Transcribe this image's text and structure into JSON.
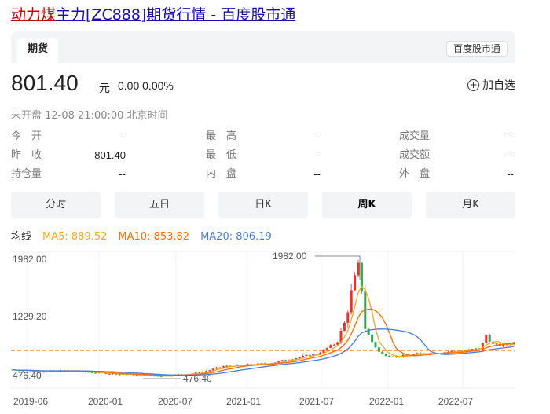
{
  "title": {
    "highlight": "动力煤",
    "rest": "主力[ZC888]期货行情 - 百度股市通"
  },
  "tab_active": "期货",
  "source_tag": "百度股市通",
  "quote": {
    "price": "801.40",
    "unit": "元",
    "change": "0.00 0.00%",
    "watch_label": "加自选"
  },
  "status": "未开盘  12-08 21:00:00  北京时间",
  "stats": [
    [
      {
        "label": "今　开",
        "value": "--"
      },
      {
        "label": "最　高",
        "value": "--"
      },
      {
        "label": "成交量",
        "value": "--"
      }
    ],
    [
      {
        "label": "昨　收",
        "value": "801.40"
      },
      {
        "label": "最　低",
        "value": "--"
      },
      {
        "label": "成交额",
        "value": "--"
      }
    ],
    [
      {
        "label": "持仓量",
        "value": "--"
      },
      {
        "label": "内　盘",
        "value": "--"
      },
      {
        "label": "外　盘",
        "value": "--"
      }
    ]
  ],
  "periods": [
    "分时",
    "五日",
    "日K",
    "周K",
    "月K"
  ],
  "active_period": "周K",
  "ma": {
    "label": "均线",
    "ma5": "MA5: 889.52",
    "ma5_color": "#f5a623",
    "ma10": "MA10: 853.82",
    "ma10_color": "#ff6a00",
    "ma20": "MA20: 806.19",
    "ma20_color": "#4a7bd8"
  },
  "chart_data": {
    "type": "candlestick",
    "y_ticks": [
      "1982.00",
      "1229.20",
      "476.40"
    ],
    "x_ticks": [
      "2019-06",
      "2020-01",
      "2020-07",
      "2021-01",
      "2021-07",
      "2022-01",
      "2022-07"
    ],
    "max_label": "1982.00",
    "min_label": "476.40",
    "ylim": [
      476.4,
      1982
    ],
    "reference_value": 801.4,
    "up_color": "#e5342b",
    "down_color": "#2fa84f",
    "ref_color": "#ff6a00"
  }
}
